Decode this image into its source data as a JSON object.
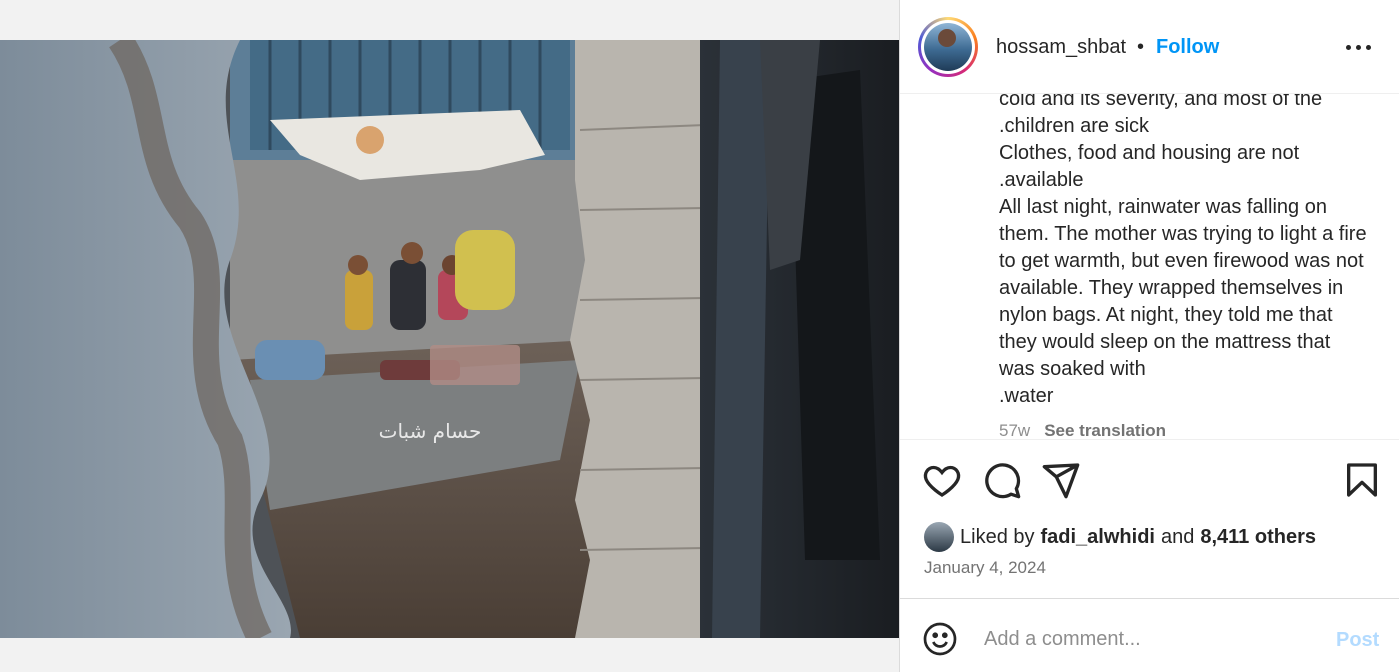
{
  "post": {
    "username": "hossam_shbat",
    "separator": "•",
    "follow_label": "Follow",
    "more_icon": "more-horizontal-icon"
  },
  "caption": {
    "text": "cold and its severity, and most of the\n.children are sick\nClothes, food and housing are not\n.available\nAll last night, rainwater was falling on them. The mother was trying to light a fire to get warmth, but even firewood was not available. They wrapped themselves in nylon bags. At night, they told me that they would sleep on the mattress that was soaked with\n.water",
    "age": "57w",
    "see_translation": "See translation"
  },
  "photo": {
    "watermark": "حسام شبات"
  },
  "actions": {
    "like_icon": "heart-icon",
    "comment_icon": "comment-icon",
    "share_icon": "share-icon",
    "save_icon": "bookmark-icon"
  },
  "likes": {
    "prefix": "Liked by",
    "first_user": "fadi_alwhidi",
    "joiner": "and",
    "others": "8,411 others"
  },
  "date": "January 4, 2024",
  "comment": {
    "placeholder": "Add a comment...",
    "post_label": "Post",
    "emoji_icon": "emoji-icon"
  },
  "colors": {
    "link": "#0095f6",
    "post_disabled": "#b3dbff",
    "muted": "#737373"
  }
}
